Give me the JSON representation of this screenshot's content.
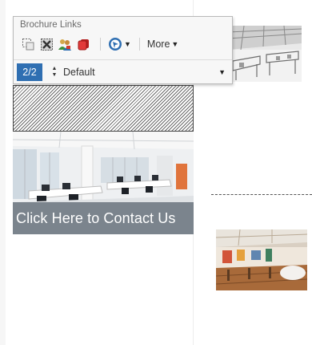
{
  "toolbar": {
    "title": "Brochure Links",
    "more_label": "More",
    "counter": "2/2",
    "style_value": "Default",
    "icons": [
      "select-area-icon",
      "delete-link-icon",
      "users-icon",
      "layers-icon",
      "target-icon"
    ]
  },
  "content": {
    "contact_text": "Click Here to Contact Us"
  },
  "colors": {
    "counter_bg": "#2f6fb2",
    "overlay_band": "#283746"
  }
}
